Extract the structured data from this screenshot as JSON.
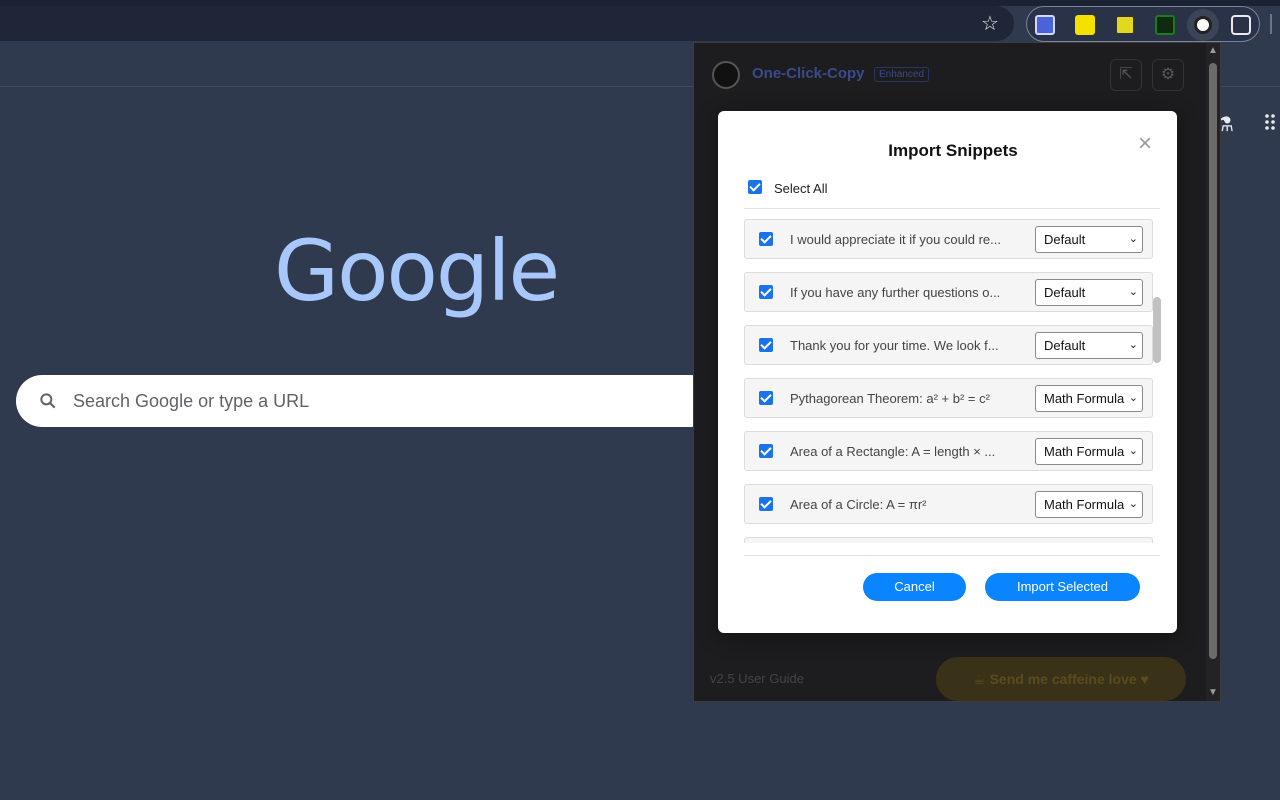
{
  "browser": {
    "extensions": [
      {
        "name": "ext-grid-icon",
        "color": "#4a64d8"
      },
      {
        "name": "ext-note-icon",
        "color": "#f5e100"
      },
      {
        "name": "ext-highlighter-icon",
        "color": "#e2d820"
      },
      {
        "name": "ext-chart-icon",
        "color": "#1e7a1e"
      },
      {
        "name": "ext-one-click-copy-icon",
        "color": "#ffffff"
      },
      {
        "name": "ext-puzzle-icon",
        "color": "#e8eaed"
      }
    ]
  },
  "ntp": {
    "logo": "Google",
    "search_placeholder": "Search Google or type a URL"
  },
  "popup": {
    "title": "One-Click-Copy",
    "badge": "Enhanced",
    "footer_link": "v2.5 User Guide",
    "coffee_button": "Send me caffeine love"
  },
  "modal": {
    "title": "Import Snippets",
    "close": "×",
    "select_all": "Select All",
    "rows": [
      {
        "text": "I would appreciate it if you could re...",
        "category": "Default"
      },
      {
        "text": "If you have any further questions o...",
        "category": "Default"
      },
      {
        "text": "Thank you for your time. We look f...",
        "category": "Default"
      },
      {
        "text": "Pythagorean Theorem: a² + b² = c²",
        "category": "Math Formula"
      },
      {
        "text": "Area of a Rectangle: A = length × ...",
        "category": "Math Formula"
      },
      {
        "text": "Area of a Circle: A = πr²",
        "category": "Math Formula"
      },
      {
        "text": "",
        "category": ""
      }
    ],
    "cancel": "Cancel",
    "import": "Import Selected"
  },
  "colors": {
    "accent": "#0a84ff",
    "checkbox": "#1a73e8",
    "google_logo": "#a8c7fa"
  }
}
